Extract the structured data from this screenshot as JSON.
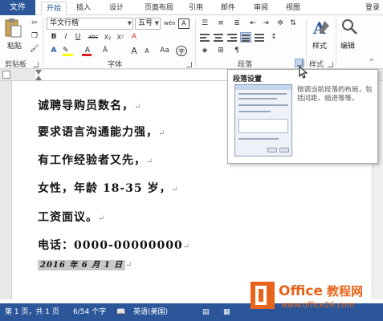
{
  "tabs": {
    "file": "文件",
    "items": [
      "开始",
      "插入",
      "设计",
      "页面布局",
      "引用",
      "邮件",
      "审阅",
      "视图"
    ],
    "login": "登录"
  },
  "ribbon": {
    "clipboard": {
      "paste": "粘贴",
      "label": "剪贴板"
    },
    "font": {
      "name": "华文行楷",
      "size": "五号",
      "wen": "wén",
      "a_box": "A",
      "bold": "B",
      "italic": "I",
      "underline": "U",
      "strike": "abc",
      "sub": "X₂",
      "sup": "X²",
      "clear": "A",
      "grow": "A",
      "shrink": "A",
      "case": "Aa",
      "label": "字体"
    },
    "paragraph": {
      "label": "段落"
    },
    "styles": {
      "name": "样式",
      "label": "样式"
    },
    "editing": {
      "name": "编辑"
    }
  },
  "document": {
    "lines": [
      "诚聘导购员数名，",
      "要求语言沟通能力强，",
      "有工作经验者又先，",
      "女性，年龄 18-35 岁，",
      "工资面议。",
      "电话：0000-00000000"
    ],
    "return_mark": "↵",
    "date": "2016 年 6 月 1 日"
  },
  "tooltip": {
    "title": "段落设置",
    "description": "微调当前段落的布局，包括间距、缩进等等。"
  },
  "status": {
    "page": "第 1 页，共 1 页",
    "words": "6/54 个字",
    "language": "英语(美国)"
  },
  "logo": {
    "brand_office": "Office",
    "brand_cn": "教程网",
    "url": "www.office26.com"
  },
  "colors": {
    "accent": "#2b579a",
    "logo_orange": "#e8641b"
  }
}
